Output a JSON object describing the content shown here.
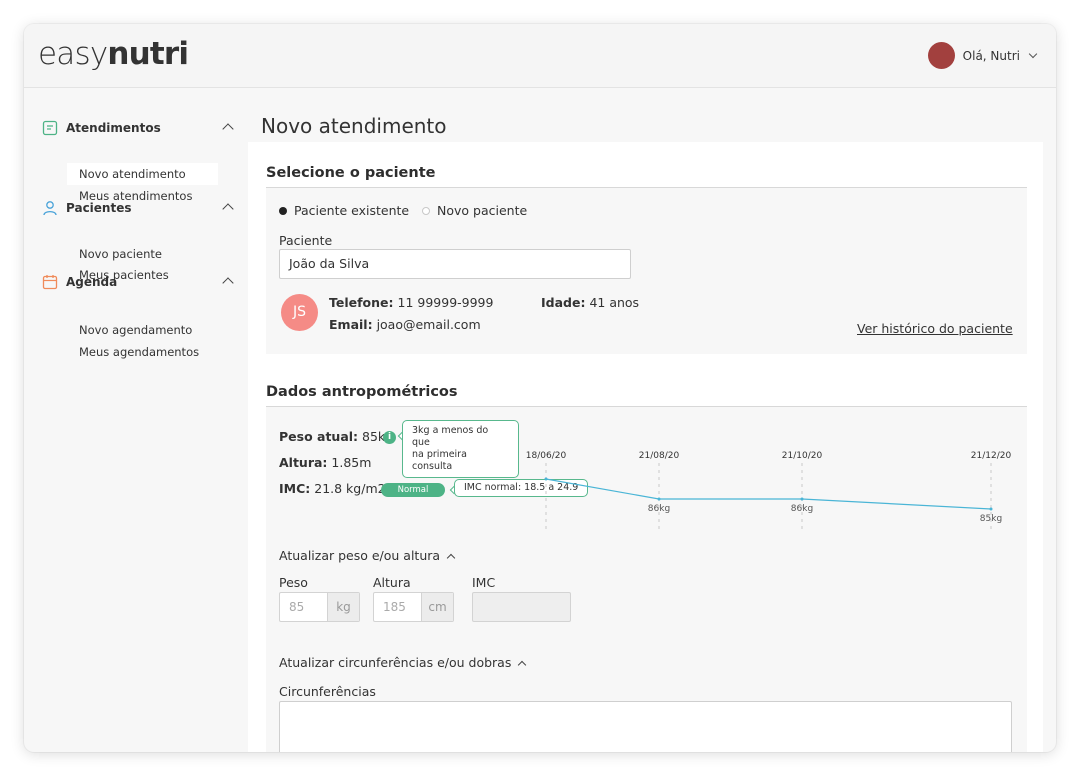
{
  "app": {
    "logo_light": "easy",
    "logo_bold": "nutri"
  },
  "user": {
    "greeting": "Olá, Nutri",
    "avatar_color": "#a2403e"
  },
  "sidebar": {
    "groups": [
      {
        "title": "Atendimentos",
        "icon": "document-icon",
        "icon_color": "#4db386",
        "items": [
          {
            "label": "Novo atendimento",
            "active": true
          },
          {
            "label": "Meus atendimentos",
            "active": false
          }
        ]
      },
      {
        "title": "Pacientes",
        "icon": "user-icon",
        "icon_color": "#4aa3d9",
        "items": [
          {
            "label": "Novo paciente"
          },
          {
            "label": "Meus pacientes"
          }
        ]
      },
      {
        "title": "Agenda",
        "icon": "calendar-icon",
        "icon_color": "#f08b5a",
        "items": [
          {
            "label": "Novo agendamento"
          },
          {
            "label": "Meus agendamentos"
          }
        ]
      }
    ]
  },
  "page": {
    "title": "Novo atendimento"
  },
  "patient_section": {
    "title": "Selecione o paciente",
    "radio_existing": "Paciente existente",
    "radio_new": "Novo paciente",
    "selected": "existing",
    "field_label": "Paciente",
    "field_value": "João da Silva",
    "initials": "JS",
    "avatar_color": "#f58b86",
    "phone_label": "Telefone:",
    "phone_value": "11 99999-9999",
    "email_label": "Email:",
    "email_value": "joao@email.com",
    "age_label": "Idade:",
    "age_value": "41 anos",
    "history_link": "Ver histórico do paciente"
  },
  "anthro_section": {
    "title": "Dados antropométricos",
    "weight_label": "Peso atual:",
    "weight_value": "85kg",
    "weight_tip_line1": "3kg a menos do que",
    "weight_tip_line2": "na primeira consulta",
    "height_label": "Altura:",
    "height_value": "1.85m",
    "bmi_label": "IMC:",
    "bmi_value": "21.8 kg/m2",
    "bmi_badge": "Normal",
    "bmi_tip": "IMC normal: 18.5 a 24.9",
    "accent_color": "#4db386",
    "line_color": "#4ab5d6"
  },
  "chart_data": {
    "type": "line",
    "x": [
      "18/06/20",
      "21/08/20",
      "21/10/20",
      "21/12/20"
    ],
    "series": [
      {
        "values": [
          88,
          86,
          86,
          85
        ]
      }
    ],
    "point_labels": [
      "",
      "86kg",
      "86kg",
      "85kg"
    ],
    "ylim": [
      84,
      89
    ]
  },
  "update_weight": {
    "title": "Atualizar peso e/ou altura",
    "weight_label": "Peso",
    "weight_placeholder": "85",
    "weight_unit": "kg",
    "height_label": "Altura",
    "height_placeholder": "185",
    "height_unit": "cm",
    "bmi_label": "IMC"
  },
  "update_circ": {
    "title": "Atualizar circunferências e/ou dobras",
    "field_label": "Circunferências"
  }
}
